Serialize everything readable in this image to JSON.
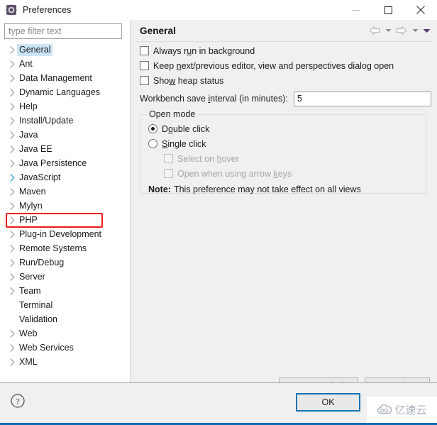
{
  "window": {
    "title": "Preferences",
    "icon": "gear-icon",
    "controls": {
      "minimize": "minimize-icon",
      "maximize": "maximize-icon",
      "close": "close-icon"
    }
  },
  "sidebar": {
    "filter": {
      "placeholder": "type filter text",
      "value": ""
    },
    "items": [
      {
        "label": "General",
        "expandable": true,
        "selected": true,
        "highlighted": false,
        "hover": false
      },
      {
        "label": "Ant",
        "expandable": true,
        "selected": false,
        "highlighted": false,
        "hover": false
      },
      {
        "label": "Data Management",
        "expandable": true,
        "selected": false,
        "highlighted": false,
        "hover": false
      },
      {
        "label": "Dynamic Languages",
        "expandable": true,
        "selected": false,
        "highlighted": false,
        "hover": false
      },
      {
        "label": "Help",
        "expandable": true,
        "selected": false,
        "highlighted": false,
        "hover": false
      },
      {
        "label": "Install/Update",
        "expandable": true,
        "selected": false,
        "highlighted": false,
        "hover": false
      },
      {
        "label": "Java",
        "expandable": true,
        "selected": false,
        "highlighted": false,
        "hover": false
      },
      {
        "label": "Java EE",
        "expandable": true,
        "selected": false,
        "highlighted": false,
        "hover": false
      },
      {
        "label": "Java Persistence",
        "expandable": true,
        "selected": false,
        "highlighted": false,
        "hover": false
      },
      {
        "label": "JavaScript",
        "expandable": true,
        "selected": false,
        "highlighted": false,
        "hover": true
      },
      {
        "label": "Maven",
        "expandable": true,
        "selected": false,
        "highlighted": false,
        "hover": false
      },
      {
        "label": "Mylyn",
        "expandable": true,
        "selected": false,
        "highlighted": false,
        "hover": false
      },
      {
        "label": "PHP",
        "expandable": true,
        "selected": false,
        "highlighted": true,
        "hover": false
      },
      {
        "label": "Plug-in Development",
        "expandable": true,
        "selected": false,
        "highlighted": false,
        "hover": false
      },
      {
        "label": "Remote Systems",
        "expandable": true,
        "selected": false,
        "highlighted": false,
        "hover": false
      },
      {
        "label": "Run/Debug",
        "expandable": true,
        "selected": false,
        "highlighted": false,
        "hover": false
      },
      {
        "label": "Server",
        "expandable": true,
        "selected": false,
        "highlighted": false,
        "hover": false
      },
      {
        "label": "Team",
        "expandable": true,
        "selected": false,
        "highlighted": false,
        "hover": false
      },
      {
        "label": "Terminal",
        "expandable": false,
        "selected": false,
        "highlighted": false,
        "hover": false
      },
      {
        "label": "Validation",
        "expandable": false,
        "selected": false,
        "highlighted": false,
        "hover": false
      },
      {
        "label": "Web",
        "expandable": true,
        "selected": false,
        "highlighted": false,
        "hover": false
      },
      {
        "label": "Web Services",
        "expandable": true,
        "selected": false,
        "highlighted": false,
        "hover": false
      },
      {
        "label": "XML",
        "expandable": true,
        "selected": false,
        "highlighted": false,
        "hover": false
      }
    ],
    "highlight_color": "#ee1c19",
    "selection_color": "#cde6f7"
  },
  "page": {
    "title": "General",
    "nav": {
      "back": "back-arrow-icon",
      "back_menu": "chevron-down-icon",
      "forward": "forward-arrow-icon",
      "forward_menu": "chevron-down-icon",
      "view_menu": "chevron-down-icon"
    },
    "checkboxes": [
      {
        "label_before": "Always r",
        "mnemonic": "u",
        "label_after": "n in background",
        "checked": false,
        "enabled": true
      },
      {
        "label_before": "Keep ",
        "mnemonic": "n",
        "label_after": "ext/previous editor, view and perspectives dialog open",
        "checked": false,
        "enabled": true
      },
      {
        "label_before": "Sho",
        "mnemonic": "w",
        "label_after": " heap status",
        "checked": false,
        "enabled": true
      }
    ],
    "interval": {
      "label_before": "Workbench save ",
      "mnemonic": "i",
      "label_after": "nterval (in minutes):",
      "value": "5"
    },
    "open_mode": {
      "legend": "Open mode",
      "radios": [
        {
          "label_before": "D",
          "mnemonic": "o",
          "label_after": "uble click",
          "checked": true
        },
        {
          "label_before": "",
          "mnemonic": "S",
          "label_after": "ingle click",
          "checked": false
        }
      ],
      "sub_checkboxes": [
        {
          "label_before": "Select on ",
          "mnemonic": "h",
          "label_after": "over",
          "checked": false,
          "enabled": false
        },
        {
          "label_before": "Open when using arrow ",
          "mnemonic": "k",
          "label_after": "eys",
          "checked": false,
          "enabled": false
        }
      ],
      "note_label": "Note:",
      "note_text": "This preference may not take effect on all views"
    },
    "buttons": {
      "restore_before": "Restore ",
      "restore_mnemonic": "D",
      "restore_after": "efaults",
      "apply_before": "",
      "apply_mnemonic": "A",
      "apply_after": "pply"
    }
  },
  "footer": {
    "help_icon": "help-question-icon",
    "ok_label": "OK",
    "ok_focus_color": "#1275b1"
  },
  "watermark": {
    "text": "亿速云",
    "icon": "cloud-icon"
  }
}
